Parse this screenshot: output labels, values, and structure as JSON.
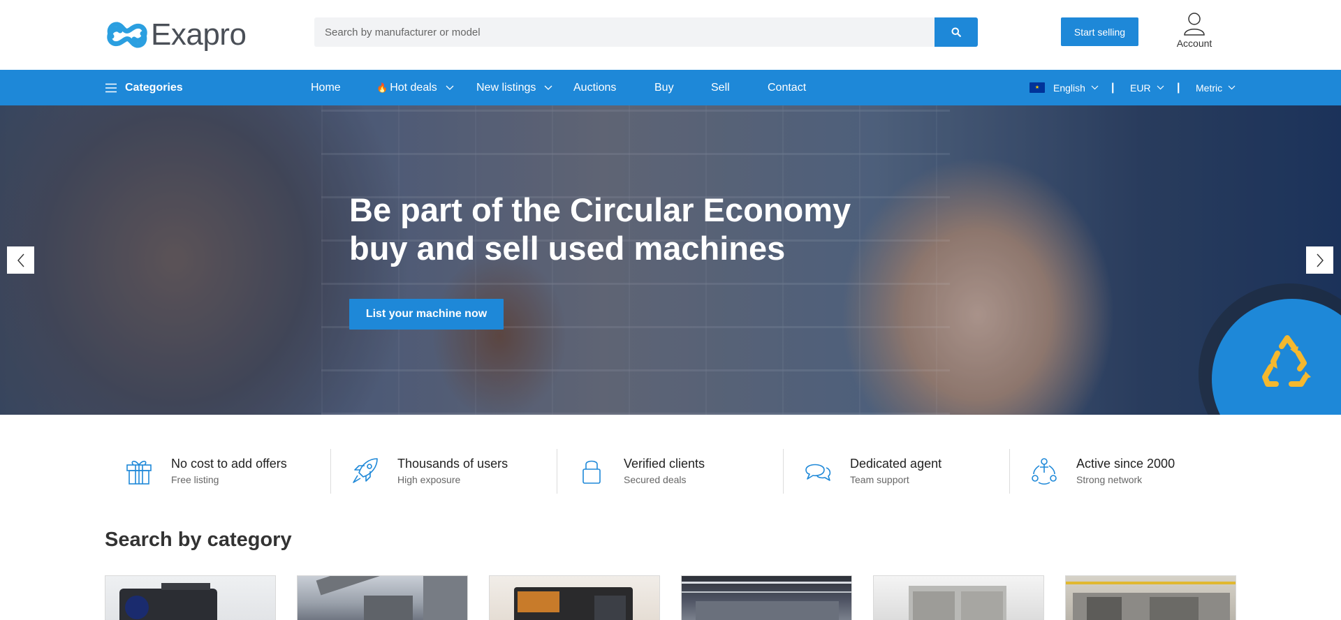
{
  "header": {
    "logo_text": "Exapro",
    "search_placeholder": "Search by manufacturer or model",
    "start_selling_label": "Start selling",
    "account_label": "Account"
  },
  "nav": {
    "categories_label": "Categories",
    "items": [
      {
        "label": "Home"
      },
      {
        "label": "Hot deals",
        "icon": "flame-icon",
        "dropdown": true
      },
      {
        "label": "New listings",
        "dropdown": true
      },
      {
        "label": "Auctions"
      },
      {
        "label": "Buy"
      },
      {
        "label": "Sell"
      },
      {
        "label": "Contact"
      }
    ],
    "language": "English",
    "currency": "EUR",
    "units": "Metric",
    "separator": "|"
  },
  "hero": {
    "title_line1": "Be part of the Circular Economy",
    "title_line2": "buy and sell used machines",
    "cta_label": "List your machine now",
    "badge_icon": "recycle-icon"
  },
  "features": [
    {
      "title": "No cost to add offers",
      "subtitle": "Free listing",
      "icon": "gift-icon"
    },
    {
      "title": "Thousands of users",
      "subtitle": "High exposure",
      "icon": "rocket-icon"
    },
    {
      "title": "Verified clients",
      "subtitle": "Secured deals",
      "icon": "lock-icon"
    },
    {
      "title": "Dedicated agent",
      "subtitle": "Team support",
      "icon": "chat-icon"
    },
    {
      "title": "Active since 2000",
      "subtitle": "Strong network",
      "icon": "network-icon"
    }
  ],
  "categories": {
    "title": "Search by category",
    "cards": [
      {
        "image": "camera-equipment-photo"
      },
      {
        "image": "excavator-photo"
      },
      {
        "image": "printer-machine-photo"
      },
      {
        "image": "factory-hall-photo"
      },
      {
        "image": "processing-machine-photo"
      },
      {
        "image": "production-line-photo"
      }
    ]
  },
  "colors": {
    "brand_blue": "#1e88d8",
    "logo_blue": "#2b9fe0",
    "logo_gray": "#4a4f57",
    "badge_yellow": "#f5b82e"
  }
}
